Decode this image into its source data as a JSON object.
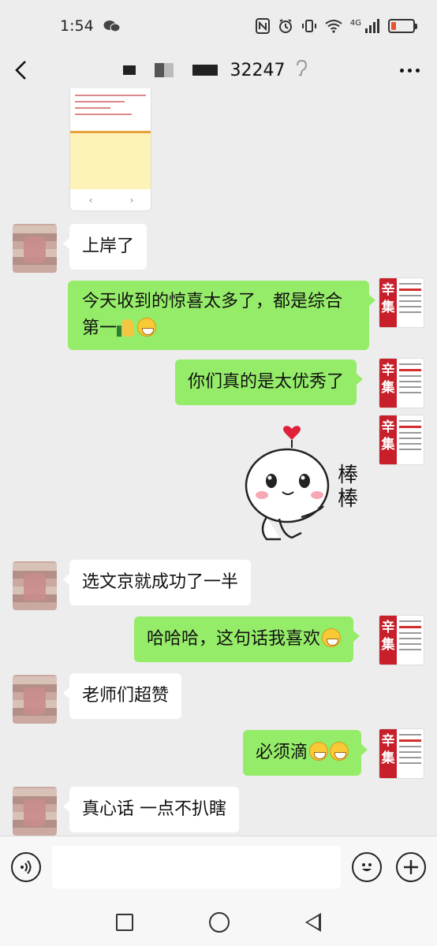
{
  "status_bar": {
    "time": "1:54",
    "network": "4G",
    "icons": [
      "wechat-icon",
      "nfc-icon",
      "alarm-icon",
      "vibrate-icon",
      "wifi-icon",
      "signal-icon",
      "battery-icon"
    ]
  },
  "header": {
    "title": "32247",
    "icons": [
      "back-icon",
      "ear-icon",
      "more-icon"
    ]
  },
  "messages": [
    {
      "side": "left",
      "text": "上岸了"
    },
    {
      "side": "right",
      "text_line1": "今天收到的惊喜太多了，都是综合",
      "text_line2": "第一"
    },
    {
      "side": "right",
      "text": "你们真的是太优秀了"
    },
    {
      "side": "right",
      "sticker_text_1": "棒",
      "sticker_text_2": "棒"
    },
    {
      "side": "left",
      "text": "选文京就成功了一半"
    },
    {
      "side": "right",
      "text": "哈哈哈，这句话我喜欢"
    },
    {
      "side": "left",
      "text": "老师们超赞"
    },
    {
      "side": "right",
      "text": "必须滴"
    },
    {
      "side": "left",
      "text": "真心话 一点不扒瞎"
    }
  ],
  "avatar_right_text": "辛集",
  "thumb_nav": {
    "left": "‹",
    "right": "›"
  },
  "theme": {
    "bubble_out": "#95ec69",
    "bubble_in": "#ffffff",
    "background": "#ededed"
  }
}
